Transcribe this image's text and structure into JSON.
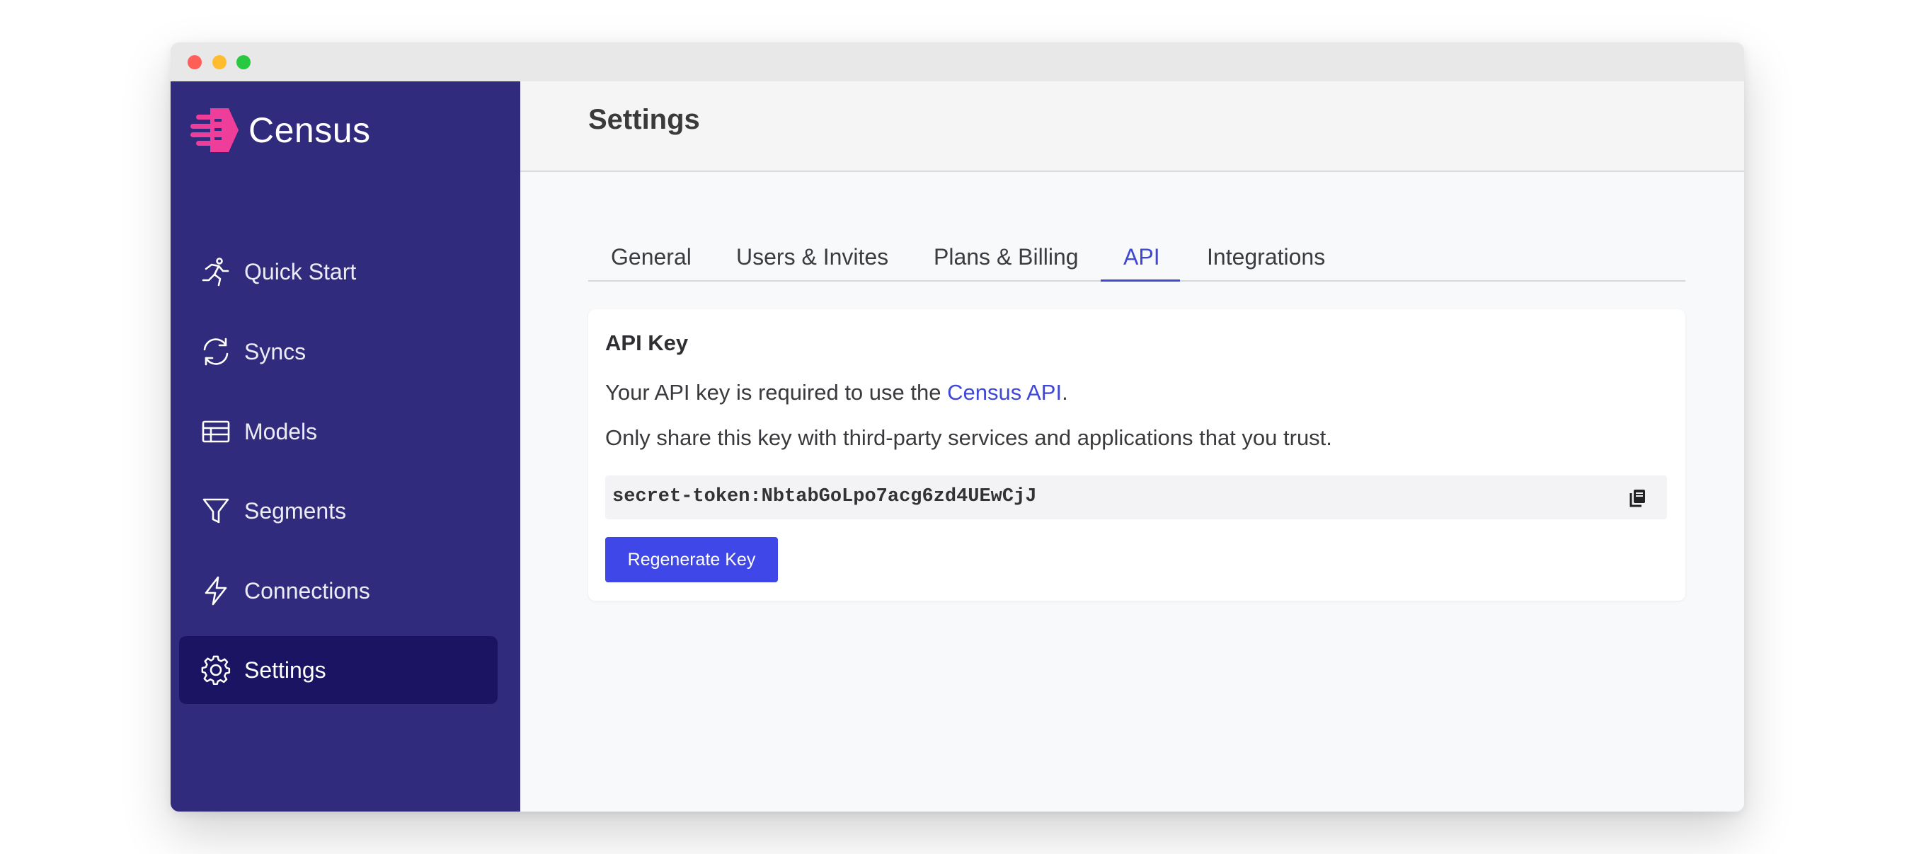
{
  "app": {
    "name": "Census",
    "brand_color": "#302b7c",
    "accent_color": "#3f47d6"
  },
  "sidebar": {
    "items": [
      {
        "label": "Quick Start",
        "icon": "running-person-icon",
        "active": false
      },
      {
        "label": "Syncs",
        "icon": "sync-arrows-icon",
        "active": false
      },
      {
        "label": "Models",
        "icon": "table-icon",
        "active": false
      },
      {
        "label": "Segments",
        "icon": "funnel-icon",
        "active": false
      },
      {
        "label": "Connections",
        "icon": "lightning-bolt-icon",
        "active": false
      },
      {
        "label": "Settings",
        "icon": "gear-icon",
        "active": true
      }
    ]
  },
  "header": {
    "title": "Settings"
  },
  "tabs": [
    {
      "label": "General",
      "active": false
    },
    {
      "label": "Users & Invites",
      "active": false
    },
    {
      "label": "Plans & Billing",
      "active": false
    },
    {
      "label": "API",
      "active": true
    },
    {
      "label": "Integrations",
      "active": false
    }
  ],
  "api_card": {
    "title": "API Key",
    "line1_prefix": "Your API key is required to use the ",
    "line1_link": "Census API",
    "line1_suffix": ".",
    "line2": "Only share this key with third-party services and applications that you trust.",
    "key_value": "secret-token:NbtabGoLpo7acg6zd4UEwCjJ",
    "copy_icon": "copy-icon",
    "regenerate_label": "Regenerate Key"
  }
}
